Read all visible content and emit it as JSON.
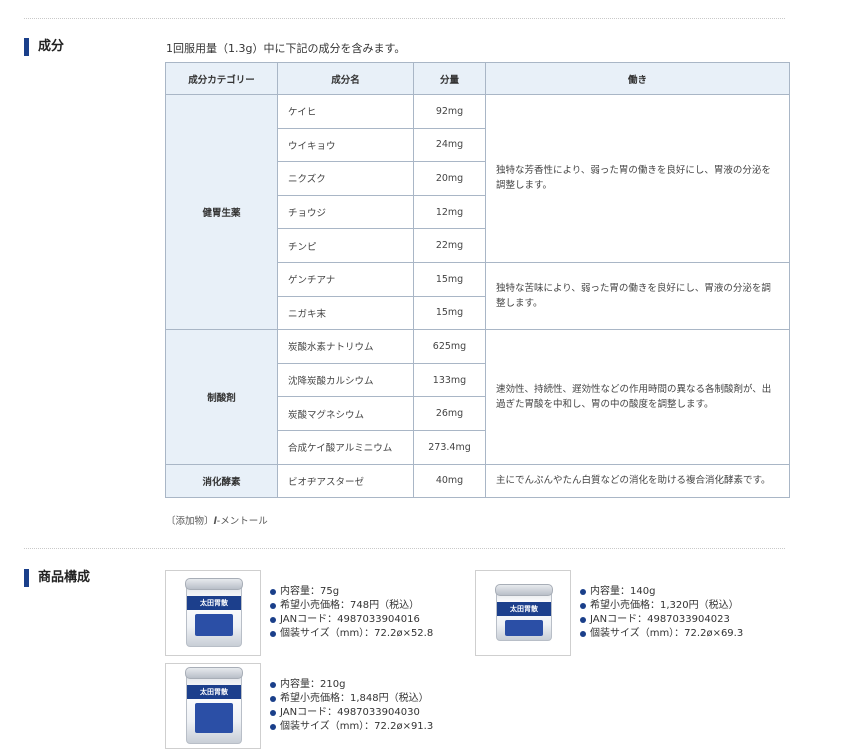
{
  "sections": {
    "ingredients_title": "成分",
    "products_title": "商品構成"
  },
  "intro": "1回服用量（1.3g）中に下記の成分を含みます。",
  "table": {
    "headers": [
      "成分カテゴリー",
      "成分名",
      "分量",
      "働き"
    ],
    "groups": [
      {
        "category": "健胃生薬",
        "rows": [
          {
            "name": "ケイヒ",
            "amount": "92mg"
          },
          {
            "name": "ウイキョウ",
            "amount": "24mg"
          },
          {
            "name": "ニクズク",
            "amount": "20mg"
          },
          {
            "name": "チョウジ",
            "amount": "12mg"
          },
          {
            "name": "チンピ",
            "amount": "22mg"
          },
          {
            "name": "ゲンチアナ",
            "amount": "15mg"
          },
          {
            "name": "ニガキ末",
            "amount": "15mg"
          }
        ],
        "effects": [
          "独特な芳香性により、弱った胃の働きを良好にし、胃液の分泌を調整します。",
          "独特な苦味により、弱った胃の働きを良好にし、胃液の分泌を調整します。"
        ]
      },
      {
        "category": "制酸剤",
        "rows": [
          {
            "name": "炭酸水素ナトリウム",
            "amount": "625mg"
          },
          {
            "name": "沈降炭酸カルシウム",
            "amount": "133mg"
          },
          {
            "name": "炭酸マグネシウム",
            "amount": "26mg"
          },
          {
            "name": "合成ケイ酸アルミニウム",
            "amount": "273.4mg"
          }
        ],
        "effects": [
          "速効性、持続性、遅効性などの作用時間の異なる各制酸剤が、出過ぎた胃酸を中和し、胃の中の酸度を調整します。"
        ]
      },
      {
        "category": "消化酵素",
        "rows": [
          {
            "name": "ビオヂアスターゼ",
            "amount": "40mg"
          }
        ],
        "effects": [
          "主にでんぷんやたん白質などの消化を助ける複合消化酵素です。"
        ]
      }
    ]
  },
  "note": {
    "prefix": "〔添加物〕",
    "italic": "l",
    "suffix": "-メントール"
  },
  "products": [
    {
      "can_label": "太田胃散",
      "details": [
        "内容量：75g",
        "希望小売価格：748円（税込）",
        "JANコード：4987033904016",
        "個装サイズ（mm）：72.2ø×52.8"
      ]
    },
    {
      "can_label": "太田胃散",
      "details": [
        "内容量：140g",
        "希望小売価格：1,320円（税込）",
        "JANコード：4987033904023",
        "個装サイズ（mm）：72.2ø×69.3"
      ]
    },
    {
      "can_label": "太田胃散",
      "details": [
        "内容量：210g",
        "希望小売価格：1,848円（税込）",
        "JANコード：4987033904030",
        "個装サイズ（mm）：72.2ø×91.3"
      ]
    }
  ],
  "colors": {
    "accent": "#1a3f8a",
    "header_bg": "#e8f0f8",
    "border": "#a9b6c6"
  }
}
